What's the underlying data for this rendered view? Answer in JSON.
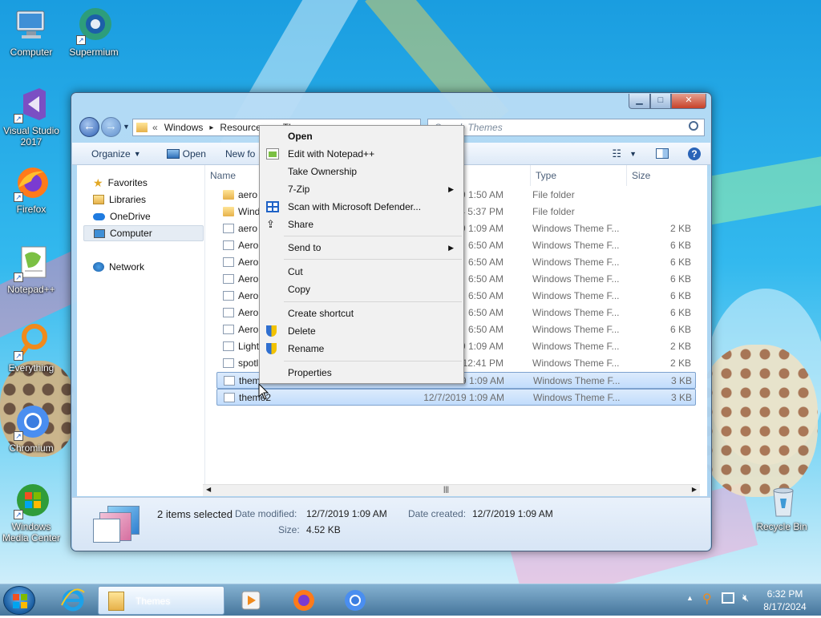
{
  "desktop_icons": [
    {
      "label": "Computer",
      "icon": "computer-icon"
    },
    {
      "label": "Supermium",
      "icon": "supermium-icon"
    },
    {
      "label": "Visual Studio 2017",
      "icon": "visual-studio-icon"
    },
    {
      "label": "Firefox",
      "icon": "firefox-icon"
    },
    {
      "label": "Notepad++",
      "icon": "notepadpp-icon"
    },
    {
      "label": "Everything",
      "icon": "everything-icon"
    },
    {
      "label": "Chromium",
      "icon": "chromium-icon"
    },
    {
      "label": "Windows Media Center",
      "icon": "media-center-icon"
    },
    {
      "label": "Recycle Bin",
      "icon": "recycle-bin-icon"
    }
  ],
  "explorer": {
    "breadcrumb": [
      "«",
      "Windows",
      "▸",
      "Resources",
      "▸",
      "Th"
    ],
    "search_placeholder": "Search Themes",
    "toolbar": {
      "organize": "Organize",
      "open": "Open",
      "new_folder": "New fo"
    },
    "nav": {
      "favorites": "Favorites",
      "libraries": "Libraries",
      "onedrive": "OneDrive",
      "computer": "Computer",
      "network": "Network"
    },
    "columns": {
      "name": "Name",
      "date": "dified",
      "type": "Type",
      "size": "Size"
    },
    "files": [
      {
        "name": "aero",
        "date": "2019 1:50 AM",
        "type": "File folder",
        "size": "",
        "kind": "folder",
        "selected": false
      },
      {
        "name": "Wind",
        "date": "4 5:37 PM",
        "type": "File folder",
        "size": "",
        "kind": "folder",
        "selected": false
      },
      {
        "name": "aero",
        "date": "2019 1:09 AM",
        "type": "Windows Theme F...",
        "size": "2 KB",
        "kind": "theme",
        "selected": false
      },
      {
        "name": "AeroF",
        "date": "6:50 AM",
        "type": "Windows Theme F...",
        "size": "6 KB",
        "kind": "theme",
        "selected": false
      },
      {
        "name": "AeroF",
        "date": "6:50 AM",
        "type": "Windows Theme F...",
        "size": "6 KB",
        "kind": "theme",
        "selected": false
      },
      {
        "name": "AeroF",
        "date": "6:50 AM",
        "type": "Windows Theme F...",
        "size": "6 KB",
        "kind": "theme",
        "selected": false
      },
      {
        "name": "AeroF",
        "date": "6:50 AM",
        "type": "Windows Theme F...",
        "size": "6 KB",
        "kind": "theme",
        "selected": false
      },
      {
        "name": "AeroF",
        "date": "6:50 AM",
        "type": "Windows Theme F...",
        "size": "6 KB",
        "kind": "theme",
        "selected": false
      },
      {
        "name": "AeroF",
        "date": "6:50 AM",
        "type": "Windows Theme F...",
        "size": "6 KB",
        "kind": "theme",
        "selected": false
      },
      {
        "name": "Light",
        "date": "2019 1:09 AM",
        "type": "Windows Theme F...",
        "size": "2 KB",
        "kind": "theme",
        "selected": false
      },
      {
        "name": "spotli",
        "date": "4 12:41 PM",
        "type": "Windows Theme F...",
        "size": "2 KB",
        "kind": "theme",
        "selected": false
      },
      {
        "name": "them",
        "date": "12/7/2019 1:09 AM",
        "type": "Windows Theme F...",
        "size": "3 KB",
        "kind": "theme",
        "selected": true
      },
      {
        "name": "theme2",
        "date": "12/7/2019 1:09 AM",
        "type": "Windows Theme F...",
        "size": "3 KB",
        "kind": "theme",
        "selected": true
      }
    ],
    "details": {
      "selection": "2 items selected",
      "date_modified_label": "Date modified:",
      "date_modified": "12/7/2019 1:09 AM",
      "date_created_label": "Date created:",
      "date_created": "12/7/2019 1:09 AM",
      "size_label": "Size:",
      "size": "4.52 KB"
    }
  },
  "context_menu": {
    "open": "Open",
    "edit_notepad": "Edit with Notepad++",
    "take_ownership": "Take Ownership",
    "sevenzip": "7-Zip",
    "scan": "Scan with Microsoft Defender...",
    "share": "Share",
    "send_to": "Send to",
    "cut": "Cut",
    "copy": "Copy",
    "create_shortcut": "Create shortcut",
    "delete": "Delete",
    "rename": "Rename",
    "properties": "Properties"
  },
  "taskbar": {
    "active_window": "Themes",
    "time": "6:32 PM",
    "date": "8/17/2024"
  },
  "colors": {
    "accent": "#1f62c6",
    "selection": "#c1dcfc",
    "taskbar": "#3c6e96"
  }
}
